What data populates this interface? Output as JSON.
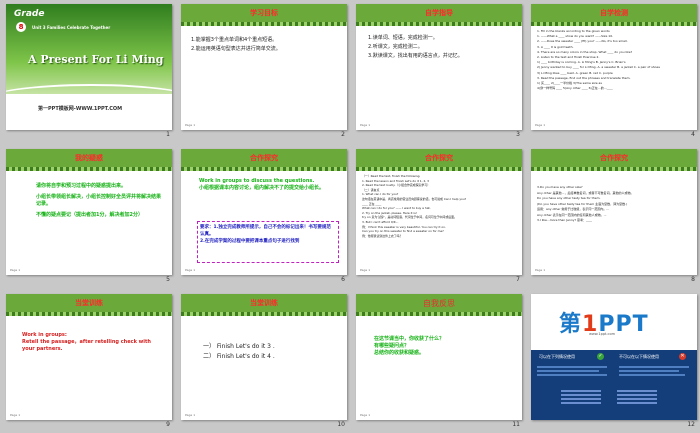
{
  "slides": [
    {
      "num": "1",
      "grade": "Grade",
      "grade_num": "8",
      "unit": "Unit 3 Families Celebrate Together",
      "title": "A Present For Li Ming",
      "site": "第一PPT模板网-WWW.1PPT.COM"
    },
    {
      "num": "2",
      "header": "学习目标",
      "lines": [
        "1.能掌握3个重点单词和4个重点短语。",
        "2.能运用英语句型表达并进行简单交流。"
      ]
    },
    {
      "num": "3",
      "header": "自学指导",
      "lines": [
        "1.读单词、短语，完成检测一。",
        "2.听课文，完成检测二。",
        "3.默读课文，找出有用的语言点，并记忆。"
      ]
    },
    {
      "num": "4",
      "header": "自学检测",
      "lines": [
        "1. Fill in the blanks according to the given words",
        "1. ——What a ____ show do you want? ——Size 10.",
        "2. ——Does the sweater ____ (fit) you? ——No, it's too small.",
        "3. A ____ it is gold teeth.",
        "4. There are so many colors in the shop. What ____ do you like?",
        "",
        "2. Listen to the text and finish Exercise 2.",
        "1) ____ birthday is coming.  A. Li Ming's  B. Jenny's  C. Brian's",
        "2) Jenny wanted to buy ____ for Li Ming.  A. a sweater  B. a jacket  C. a pair of shoes",
        "3) Li Ming likes ____ best.  A. green  B. red  C. purple",
        "",
        "3. Read the passage, find out the phrases and translate them.",
        "1) 买____  2)____一半价格  3)The same size as",
        "4)穿一样号码 ____  5)Any other ____ 6)正在…的…____"
      ]
    },
    {
      "num": "5",
      "header": "我的疑惑",
      "lines": [
        "请你将自学和预习过程中的疑惑提出来。",
        "小组长带领组长解决，小组长控制好全员评并将解决结果记录。",
        "不懂的疑点要记（提出者加1分，解决者加2分）"
      ]
    },
    {
      "num": "6",
      "header": "合作探究",
      "lines": [
        "Work in groups to discuss the questions.",
        "小组根据课本内容讨论，组内解决不了的提交给小组长。",
        "要求：1.独立完成教师所提示，自己不会的标记出来！书写要规范认真。",
        "2.在完成学案的过程中要把课本重点句子进行找到"
      ]
    },
    {
      "num": "7",
      "header": "合作探究",
      "lines": [
        "（一）Read the text, finish the following.",
        "1. Read the lesson and finish Let's do it 1, 2, 3",
        "2. Read the text loudly.（小组合作完成探究学习）",
        "",
        "（二）语言点",
        "1. What can I do for you?",
        "   这句话在英语中是，商店常用的营业员向顾客说的话，也可说成 Can I help you?",
        "   ____ 正在 ____",
        "   What can I do for you?  —— I want to buy a hat.",
        "2. Try on the jacket, please. Here it is!",
        "   try on 意为'试穿'，是动词短语，代词位于中间，名词可位于中间或后面。",
        "3. But I can't afford it/it...",
        "   例：I think this sweater is very beautiful. You can try it on.",
        "   Can you try on this sweater to find a sweater on for me?",
        "   例：他帮我试穿这件上衣了吗？"
      ]
    },
    {
      "num": "8",
      "header": "合作探究",
      "lines": [
        "3.Do you have any other size?",
        "",
        "Any other 是其他...，后接单数名词，或者不可数名词。其他的人或物。",
        "Do you have any other tasty tea for them.",
        "(Do you have other tasty tea for them 主语为复数，译为复数.)",
        "",
        "运用：any other 常用于比较级，表示同一范围内。...",
        "Any other 表示在同一范围内的任何其他人或物。...",
        "3.I like...more than Jenny? 思考：____"
      ]
    },
    {
      "num": "9",
      "header": "当堂训练",
      "lines": [
        "Work in groups:",
        "Retell the passage，after retelling check with your partners."
      ]
    },
    {
      "num": "10",
      "header": "当堂训练",
      "lines": [
        "一） Finish  Let's do it 3 .",
        "二） Finish  Let's do it 4 ."
      ]
    },
    {
      "num": "11",
      "header": "自我反思",
      "lines": [
        "在这节课当中，你收获了什么？",
        "有哪些疑问点？",
        "总结你的收获和疑惑。"
      ]
    },
    {
      "num": "12",
      "logo_text": "第",
      "logo_one": "1",
      "logo_rest": "PPT",
      "logo_sub": "www.1ppt.com",
      "col1": "可以在下列情况使用",
      "col2": "不可以在以下情况使用"
    }
  ],
  "footer_text": "Page 1",
  "colors": {
    "band": "#6aa93a",
    "band_dark": "#3e7d1e",
    "header_text": "#ff2a2a",
    "green_text": "#18b318",
    "navy": "#143e7a"
  }
}
